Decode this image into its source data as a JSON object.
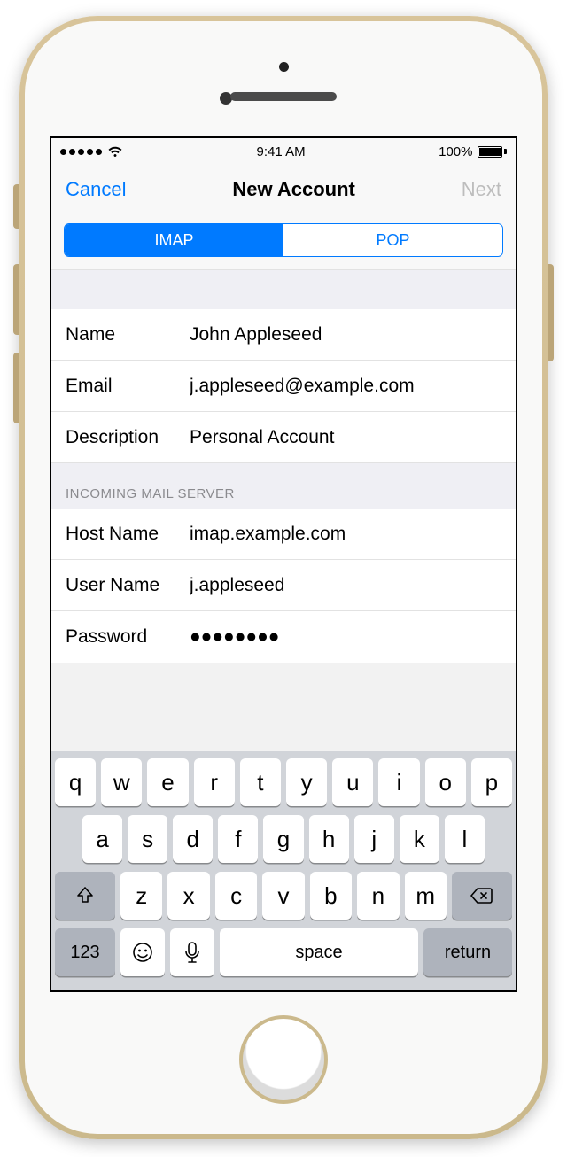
{
  "status": {
    "time": "9:41 AM",
    "battery": "100%"
  },
  "nav": {
    "cancel": "Cancel",
    "title": "New Account",
    "next": "Next"
  },
  "tabs": {
    "imap": "IMAP",
    "pop": "POP",
    "active": "imap"
  },
  "fields": {
    "name": {
      "label": "Name",
      "value": "John Appleseed"
    },
    "email": {
      "label": "Email",
      "value": "j.appleseed@example.com"
    },
    "description": {
      "label": "Description",
      "value": "Personal Account"
    }
  },
  "incoming": {
    "header": "INCOMING MAIL SERVER",
    "host": {
      "label": "Host Name",
      "value": "imap.example.com"
    },
    "user": {
      "label": "User Name",
      "value": "j.appleseed"
    },
    "pass": {
      "label": "Password",
      "value": "●●●●●●●●"
    }
  },
  "keyboard": {
    "row1": [
      "q",
      "w",
      "e",
      "r",
      "t",
      "y",
      "u",
      "i",
      "o",
      "p"
    ],
    "row2": [
      "a",
      "s",
      "d",
      "f",
      "g",
      "h",
      "j",
      "k",
      "l"
    ],
    "row3": [
      "z",
      "x",
      "c",
      "v",
      "b",
      "n",
      "m"
    ],
    "numbers": "123",
    "space": "space",
    "return": "return"
  }
}
